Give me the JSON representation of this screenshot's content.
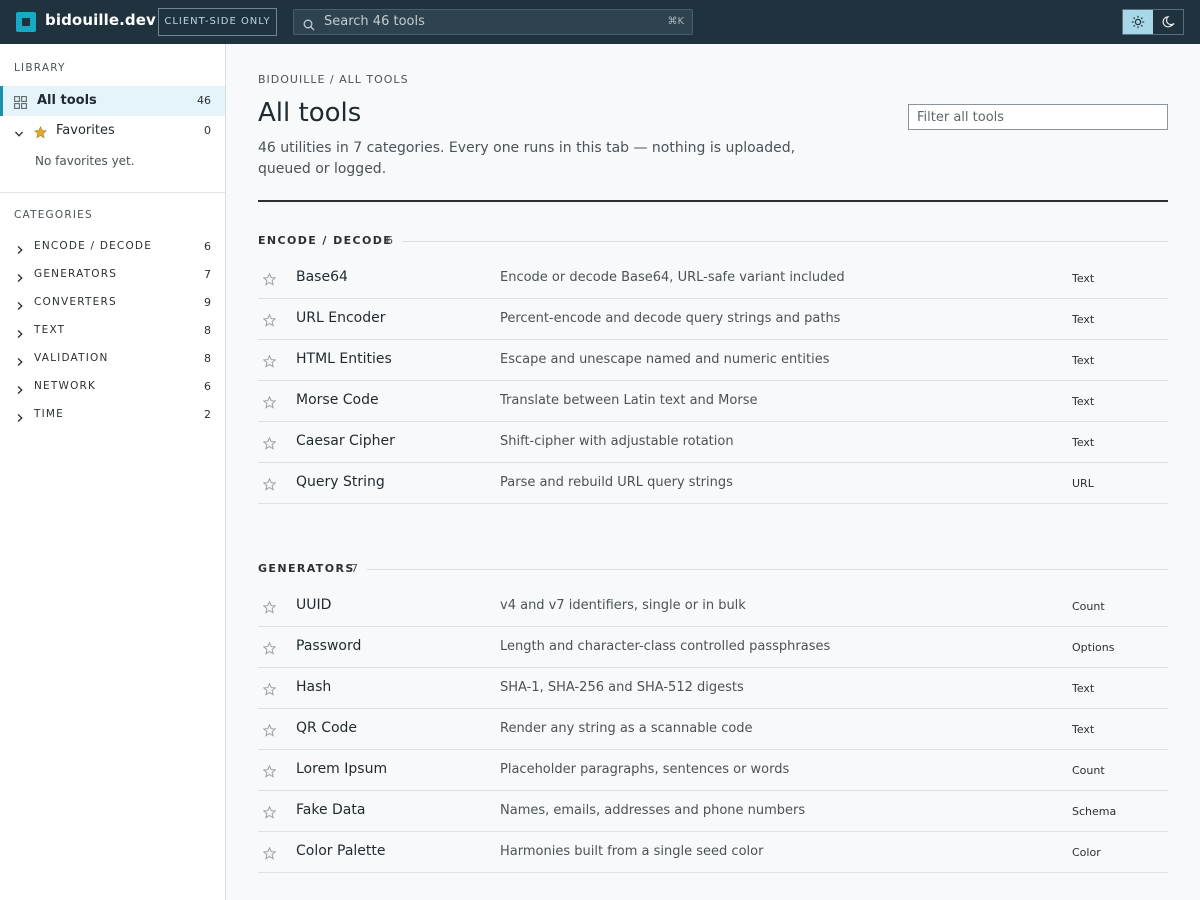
{
  "header": {
    "brand": "bidouille.dev",
    "badge": "CLIENT-SIDE ONLY",
    "search_placeholder": "Search 46 tools",
    "search_shortcut": "⌘K",
    "icons": {
      "logo": "logo-mark",
      "search": "search-icon",
      "light": "sun-icon",
      "dark": "moon-icon"
    }
  },
  "sidebar": {
    "library_heading": "LIBRARY",
    "all_tools": {
      "label": "All tools",
      "count": "46"
    },
    "favorites": {
      "label": "Favorites",
      "count": "0",
      "empty": "No favorites yet."
    },
    "categories_heading": "CATEGORIES",
    "categories": [
      {
        "label": "ENCODE / DECODE",
        "count": "6"
      },
      {
        "label": "GENERATORS",
        "count": "7"
      },
      {
        "label": "CONVERTERS",
        "count": "9"
      },
      {
        "label": "TEXT",
        "count": "8"
      },
      {
        "label": "VALIDATION",
        "count": "8"
      },
      {
        "label": "NETWORK",
        "count": "6"
      },
      {
        "label": "TIME",
        "count": "2"
      }
    ]
  },
  "main": {
    "breadcrumb": "BIDOUILLE / ALL TOOLS",
    "title": "All tools",
    "subtitle": "46 utilities in 7 categories. Every one runs in this tab — nothing is uploaded, queued or logged.",
    "filter_placeholder": "Filter all tools",
    "sections": [
      {
        "name": "ENCODE / DECODE",
        "count": "6",
        "tools": [
          {
            "name": "Base64",
            "desc": "Encode or decode Base64, URL-safe variant included",
            "tag": "Text"
          },
          {
            "name": "URL Encoder",
            "desc": "Percent-encode and decode query strings and paths",
            "tag": "Text"
          },
          {
            "name": "HTML Entities",
            "desc": "Escape and unescape named and numeric entities",
            "tag": "Text"
          },
          {
            "name": "Morse Code",
            "desc": "Translate between Latin text and Morse",
            "tag": "Text"
          },
          {
            "name": "Caesar Cipher",
            "desc": "Shift-cipher with adjustable rotation",
            "tag": "Text"
          },
          {
            "name": "Query String",
            "desc": "Parse and rebuild URL query strings",
            "tag": "URL"
          }
        ]
      },
      {
        "name": "GENERATORS",
        "count": "7",
        "tools": [
          {
            "name": "UUID",
            "desc": "v4 and v7 identifiers, single or in bulk",
            "tag": "Count"
          },
          {
            "name": "Password",
            "desc": "Length and character-class controlled passphrases",
            "tag": "Options"
          },
          {
            "name": "Hash",
            "desc": "SHA-1, SHA-256 and SHA-512 digests",
            "tag": "Text"
          },
          {
            "name": "QR Code",
            "desc": "Render any string as a scannable code",
            "tag": "Text"
          },
          {
            "name": "Lorem Ipsum",
            "desc": "Placeholder paragraphs, sentences or words",
            "tag": "Count"
          },
          {
            "name": "Fake Data",
            "desc": "Names, emails, addresses and phone numbers",
            "tag": "Schema"
          },
          {
            "name": "Color Palette",
            "desc": "Harmonies built from a single seed color",
            "tag": "Color"
          }
        ]
      }
    ]
  },
  "colors": {
    "topbar": "#1f323d",
    "accent": "#18a9c4",
    "active_bg": "#e4f4f8",
    "star": "#e3a92b"
  }
}
